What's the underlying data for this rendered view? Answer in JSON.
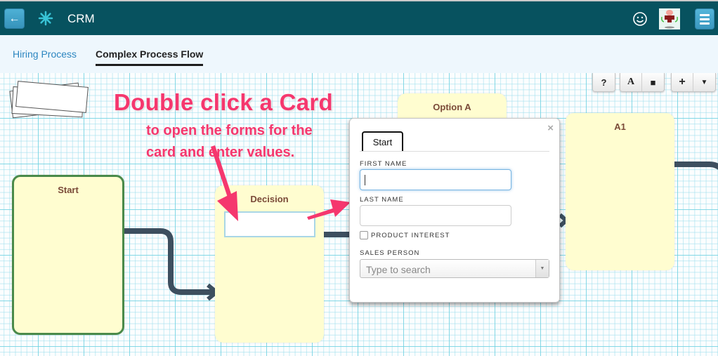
{
  "header": {
    "back_icon": "arrow-left-icon",
    "logo_icon": "asterisk-burst-icon",
    "app_title": "CRM",
    "user_status_icon": "smiley-icon",
    "avatar_icon": "user-avatar-image",
    "menu_icon": "hamburger-menu-icon"
  },
  "tabs": [
    {
      "label": "Hiring Process",
      "active": false
    },
    {
      "label": "Complex Process Flow",
      "active": true
    }
  ],
  "toolbar": {
    "help_label": "?",
    "text_label": "A",
    "shape_label": "■",
    "add_label": "+",
    "filter_label": "▼"
  },
  "callout": {
    "title": "Double click a Card",
    "body": "to open the forms for the card and enter values."
  },
  "cards": {
    "start": "Start",
    "decision": "Decision",
    "option_a": "Option A",
    "a1": "A1"
  },
  "form_popup": {
    "close_label": "×",
    "tab_label": "Start",
    "fields": {
      "first_name": {
        "label": "FIRST NAME",
        "value": ""
      },
      "last_name": {
        "label": "LAST NAME",
        "value": ""
      },
      "product_interest": {
        "label": "PRODUCT INTEREST",
        "checked": false
      },
      "sales_person": {
        "label": "SALES PERSON",
        "placeholder": "Type to search",
        "value": ""
      }
    }
  },
  "colors": {
    "header_bg": "#07525f",
    "accent_blue": "#3a97bf",
    "callout_pink": "#f5376e",
    "card_fill": "#fffdd0",
    "start_border": "#4a8a4a",
    "connector": "#3d4f5f"
  }
}
